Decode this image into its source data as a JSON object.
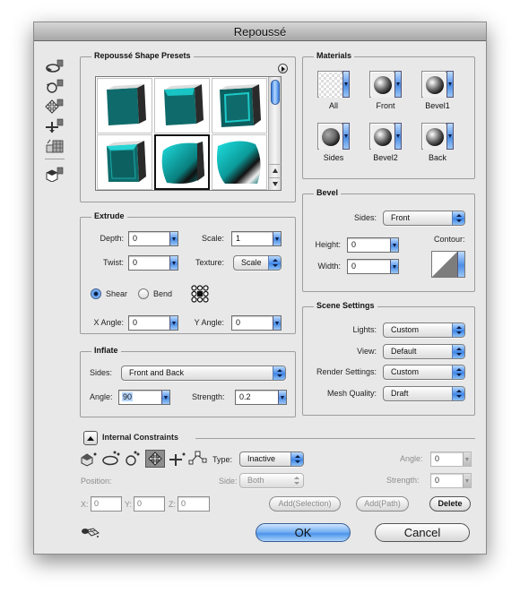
{
  "window": {
    "title": "Repoussé"
  },
  "toolbar": {
    "items": [
      {
        "name": "rotate-3d-object-tool",
        "icon": "rotate-3d-icon"
      },
      {
        "name": "roll-3d-object-tool",
        "icon": "roll-3d-icon"
      },
      {
        "name": "drag-3d-object-tool",
        "icon": "drag-3d-icon"
      },
      {
        "name": "slide-3d-object-tool",
        "icon": "slide-3d-icon"
      },
      {
        "name": "scale-3d-object-tool",
        "icon": "scale-3d-icon"
      },
      {
        "name": "3d-camera-tool",
        "icon": "camera-3d-icon"
      }
    ]
  },
  "presets": {
    "title": "Repoussé Shape Presets",
    "menu_icon": "flyout-menu-icon",
    "items": [
      {
        "name": "extrude",
        "selected": false
      },
      {
        "name": "bevel-frame",
        "selected": false
      },
      {
        "name": "inset-frame",
        "selected": false
      },
      {
        "name": "bevel-box",
        "selected": false
      },
      {
        "name": "inflate",
        "selected": true
      },
      {
        "name": "inflate-sides",
        "selected": false
      }
    ]
  },
  "materials": {
    "title": "Materials",
    "items": [
      {
        "label": "All",
        "kind": "checker"
      },
      {
        "label": "Front",
        "kind": "sphere"
      },
      {
        "label": "Bevel1",
        "kind": "sphere"
      },
      {
        "label": "Sides",
        "kind": "sphere-dark"
      },
      {
        "label": "Bevel2",
        "kind": "sphere"
      },
      {
        "label": "Back",
        "kind": "sphere"
      }
    ]
  },
  "extrude": {
    "title": "Extrude",
    "depth_label": "Depth:",
    "depth": "0",
    "scale_label": "Scale:",
    "scale": "1",
    "twist_label": "Twist:",
    "twist": "0",
    "texture_label": "Texture:",
    "texture": "Scale",
    "shear_label": "Shear",
    "bend_label": "Bend",
    "mode": "Shear",
    "xangle_label": "X Angle:",
    "xangle": "0",
    "yangle_label": "Y Angle:",
    "yangle": "0"
  },
  "bevel": {
    "title": "Bevel",
    "sides_label": "Sides:",
    "sides": "Front",
    "height_label": "Height:",
    "height": "0",
    "width_label": "Width:",
    "width": "0",
    "contour_label": "Contour:"
  },
  "scene": {
    "title": "Scene Settings",
    "lights_label": "Lights:",
    "lights": "Custom",
    "view_label": "View:",
    "view": "Default",
    "render_label": "Render Settings:",
    "render": "Custom",
    "mesh_label": "Mesh Quality:",
    "mesh": "Draft"
  },
  "inflate": {
    "title": "Inflate",
    "sides_label": "Sides:",
    "sides": "Front and Back",
    "angle_label": "Angle:",
    "angle": "90",
    "strength_label": "Strength:",
    "strength": "0.2"
  },
  "constraints": {
    "title": "Internal Constraints",
    "type_label": "Type:",
    "type": "Inactive",
    "position_label": "Position:",
    "side_label": "Side:",
    "side": "Both",
    "angle_label": "Angle:",
    "angle": "0",
    "strength_label": "Strength:",
    "strength": "0",
    "x_label": "X:",
    "x": "0",
    "y_label": "Y:",
    "y": "0",
    "z_label": "Z:",
    "z": "0",
    "add_selection": "Add(Selection)",
    "add_path": "Add(Path)",
    "delete": "Delete"
  },
  "footer": {
    "ok": "OK",
    "cancel": "Cancel",
    "mesh_icon": "mesh-preview-icon"
  }
}
